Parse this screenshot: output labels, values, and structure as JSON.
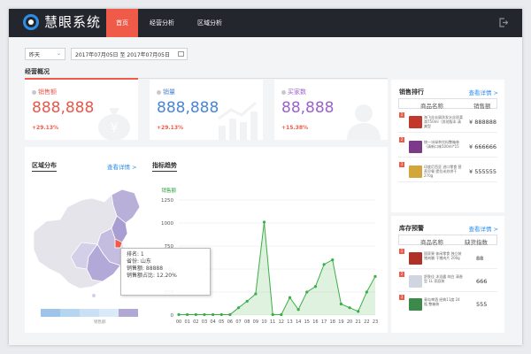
{
  "app": {
    "brand": "慧眼系统"
  },
  "nav": {
    "items": [
      {
        "label": "首页"
      },
      {
        "label": "经营分析"
      },
      {
        "label": "区域分析"
      }
    ]
  },
  "filters": {
    "period": "昨天",
    "range_start": "2017年07月05日",
    "range_sep": "至",
    "range_end": "2017年07月05日"
  },
  "overview": {
    "title": "经营概况"
  },
  "kpis": [
    {
      "label": "销售额",
      "value": "888,888",
      "change": "+29.13%",
      "color": "#e8594b"
    },
    {
      "label": "销量",
      "value": "888,888",
      "change": "+29.13%",
      "color": "#4a86d6"
    },
    {
      "label": "买家数",
      "value": "88,888",
      "change": "+15.38%",
      "color": "#9b62cc"
    }
  ],
  "region": {
    "title": "区域分布",
    "link": "查看详情 >",
    "legend_label": "销售额",
    "tooltip": {
      "rank": "排名: 1",
      "province": "省份: 山东",
      "sales": "销售额: 88888",
      "share": "销售额占比: 12.20%"
    }
  },
  "trend": {
    "title": "指标趋势"
  },
  "chart_data": {
    "type": "area",
    "ylabel": "销售额",
    "ylim": [
      0,
      1250
    ],
    "yticks": [
      0,
      250,
      500,
      750,
      1000,
      1250
    ],
    "categories": [
      "00",
      "01",
      "02",
      "03",
      "04",
      "05",
      "06",
      "07",
      "08",
      "09",
      "10",
      "11",
      "12",
      "13",
      "14",
      "15",
      "16",
      "17",
      "18",
      "19",
      "20",
      "21",
      "22",
      "23"
    ],
    "series": [
      {
        "name": "销售额",
        "values": [
          5,
          5,
          5,
          5,
          5,
          5,
          5,
          80,
          150,
          230,
          1010,
          5,
          5,
          190,
          60,
          250,
          310,
          550,
          600,
          120,
          80,
          40,
          250,
          420
        ]
      }
    ]
  },
  "sales_rank": {
    "title": "销售排行",
    "link": "查看详情 >",
    "col_name": "商品名称",
    "col_value": "销售额",
    "rows": [
      {
        "rank": "1",
        "name": "海飞丝去屑洗发水丝质柔滑750ml（其他版本 清爽型",
        "value": "¥ 888888",
        "color": "#c0392b"
      },
      {
        "rank": "2",
        "name": "统一冰绿茶饮料整箱装（清新口味500ml*15",
        "value": "¥ 666666",
        "color": "#7b3b8a"
      },
      {
        "rank": "3",
        "name": "印度尼西亚 进口零食 营养早餐 提拉米苏饼干 270g",
        "value": "¥ 555555",
        "color": "#d4a53a"
      }
    ]
  },
  "stock_warning": {
    "title": "库存预警",
    "link": "查看详情 >",
    "col_name": "商品名称",
    "col_value": "缺货指数",
    "rows": [
      {
        "rank": "1",
        "name": "国家果 休闲零食 独立装猪肉脯 干猪肉片 200g",
        "value": "88",
        "color": "#b03226"
      },
      {
        "rank": "2",
        "name": "舒肤佳 沐浴露 纯白 清香型 1L 家庭装",
        "value": "666",
        "color": "#d0d6e0"
      },
      {
        "rank": "3",
        "name": "青岛啤酒 经典11度 24瓶 整箱装",
        "value": "555",
        "color": "#3c8a4a"
      }
    ]
  }
}
